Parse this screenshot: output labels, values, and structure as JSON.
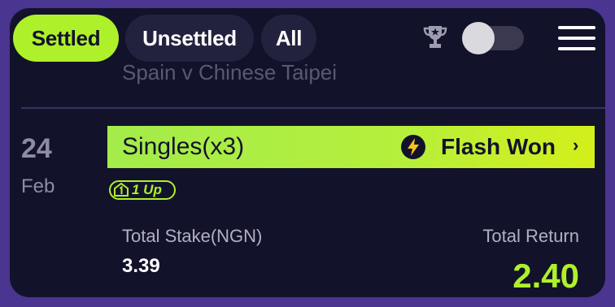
{
  "tabs": [
    {
      "label": "Settled",
      "active": true
    },
    {
      "label": "Unsettled",
      "active": false
    },
    {
      "label": "All",
      "active": false
    }
  ],
  "icons": {
    "trophy": "trophy-icon",
    "toggle": "off",
    "menu": "hamburger-menu-icon",
    "flash": "lightning-bolt-icon"
  },
  "previous_item": {
    "text": "Spain v Chinese Taipei"
  },
  "bet": {
    "date_day": "24",
    "date_month": "Feb",
    "title": "Singles(x3)",
    "status": "Flash Won",
    "badge": "1 Up",
    "stake_label": "Total Stake(NGN)",
    "stake_value": "3.39",
    "return_label": "Total Return",
    "return_value": "2.40"
  },
  "colors": {
    "accent": "#aef12a",
    "background": "#13122b",
    "border": "#4a3590"
  }
}
